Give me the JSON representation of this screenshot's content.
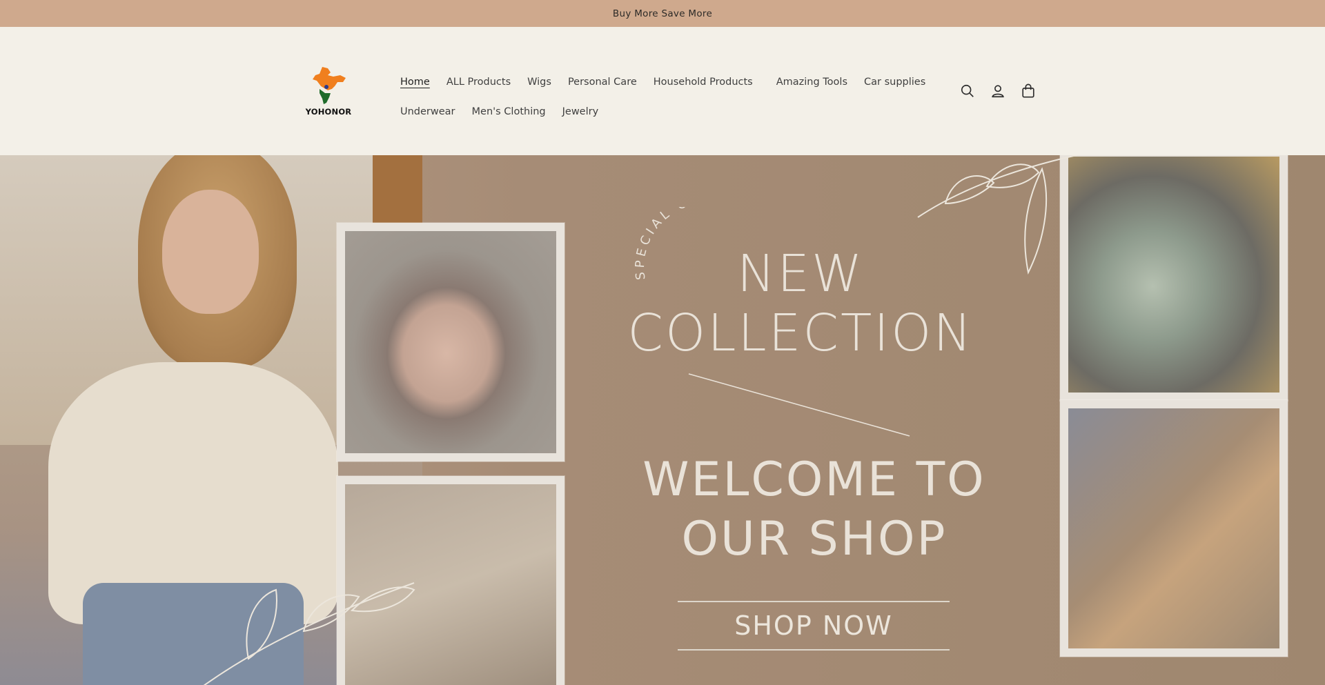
{
  "announcement": {
    "text": "Buy More Save More"
  },
  "logo": {
    "text": "YOHONOR"
  },
  "nav": {
    "row1": [
      {
        "label": "Home",
        "active": true
      },
      {
        "label": "ALL Products"
      },
      {
        "label": "Wigs"
      },
      {
        "label": "Personal Care"
      },
      {
        "label": "Household Products"
      },
      {
        "label": "Amazing Tools"
      },
      {
        "label": "Car supplies"
      }
    ],
    "row2": [
      {
        "label": "Underwear"
      },
      {
        "label": "Men's Clothing"
      },
      {
        "label": "Jewelry"
      }
    ]
  },
  "header_icons": [
    "search-icon",
    "account-icon",
    "cart-icon"
  ],
  "hero": {
    "special_offer": "SPECIAL OFFER",
    "title_line1": "NEW",
    "title_line2": "COLLECTION",
    "welcome_line1": "WELCOME TO",
    "welcome_line2": "OUR SHOP",
    "cta": "SHOP NOW"
  },
  "colors": {
    "announcement_bg": "#cfa98d",
    "header_bg": "#f3f0e8",
    "hero_text": "#e9e2d8"
  }
}
